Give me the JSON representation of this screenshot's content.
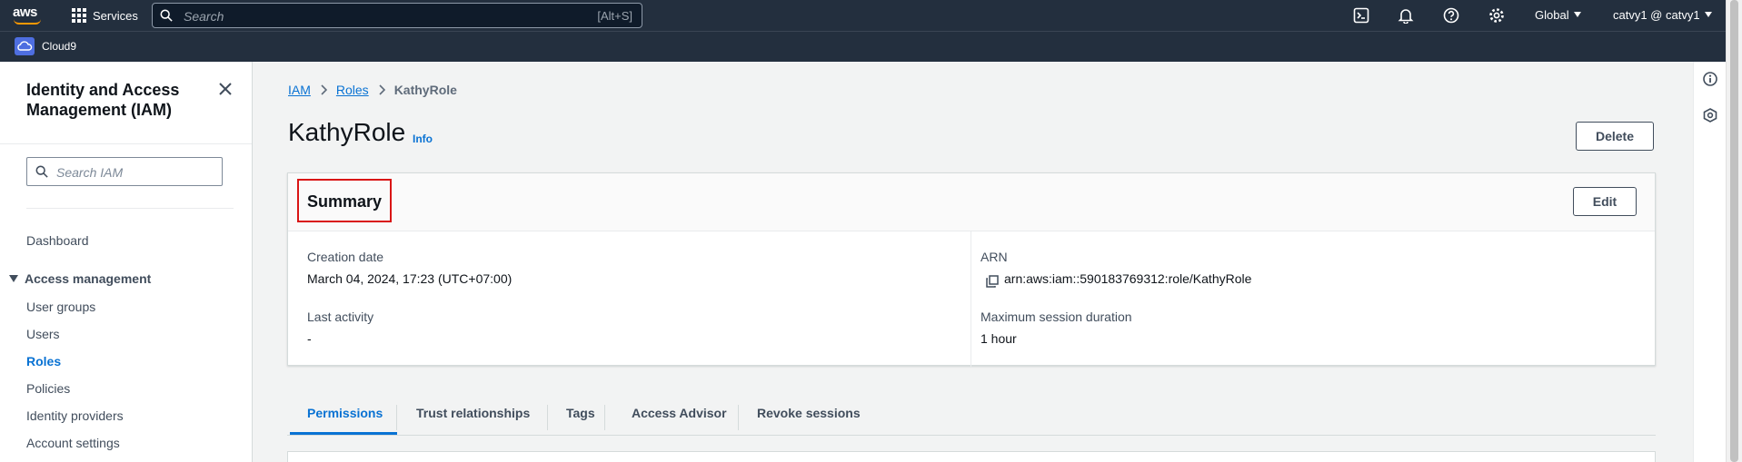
{
  "topbar": {
    "logo": "aws",
    "services_label": "Services",
    "search_placeholder": "Search",
    "search_shortcut": "[Alt+S]",
    "region": "Global",
    "account": "catvy1 @ catvy1",
    "icons": [
      "cloudshell-icon",
      "notifications-bell-icon",
      "help-icon",
      "settings-gear-icon"
    ]
  },
  "subbar": {
    "service_shortcut": "Cloud9"
  },
  "sidebar": {
    "title": "Identity and Access Management (IAM)",
    "search_placeholder": "Search IAM",
    "dashboard": "Dashboard",
    "group_label": "Access management",
    "items": [
      "User groups",
      "Users",
      "Roles",
      "Policies",
      "Identity providers",
      "Account settings"
    ],
    "active_item": "Roles"
  },
  "breadcrumb": {
    "items": [
      "IAM",
      "Roles"
    ],
    "current": "KathyRole"
  },
  "page": {
    "title": "KathyRole",
    "info": "Info",
    "delete_label": "Delete"
  },
  "summary": {
    "title": "Summary",
    "edit_label": "Edit",
    "creation_date_label": "Creation date",
    "creation_date": "March 04, 2024, 17:23 (UTC+07:00)",
    "last_activity_label": "Last activity",
    "last_activity": "-",
    "arn_label": "ARN",
    "arn": "arn:aws:iam::590183769312:role/KathyRole",
    "max_session_label": "Maximum session duration",
    "max_session": "1 hour"
  },
  "tabs": {
    "items": [
      "Permissions",
      "Trust relationships",
      "Tags",
      "Access Advisor",
      "Revoke sessions"
    ],
    "active": "Permissions"
  },
  "colors": {
    "nav_bg": "#232f3e",
    "link": "#0972d3",
    "highlight_border": "#d91515",
    "brand_orange": "#ff9900"
  }
}
